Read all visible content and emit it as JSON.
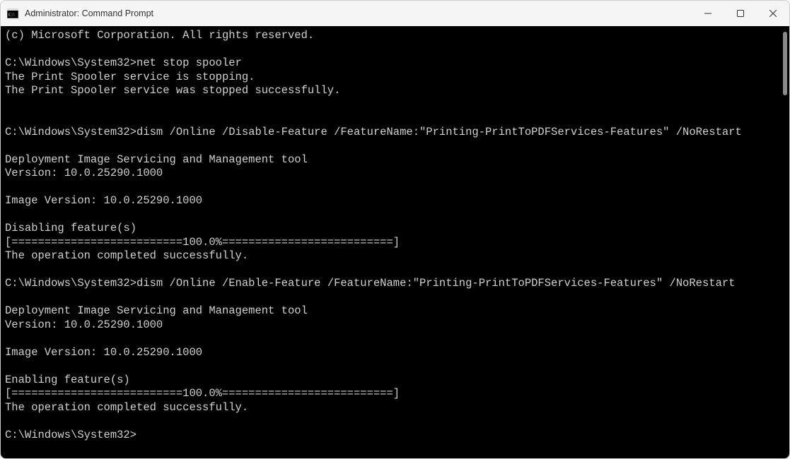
{
  "titlebar": {
    "title": "Administrator: Command Prompt"
  },
  "terminal": {
    "lines": [
      "(c) Microsoft Corporation. All rights reserved.",
      "",
      "C:\\Windows\\System32>net stop spooler",
      "The Print Spooler service is stopping.",
      "The Print Spooler service was stopped successfully.",
      "",
      "",
      "C:\\Windows\\System32>dism /Online /Disable-Feature /FeatureName:\"Printing-PrintToPDFServices-Features\" /NoRestart",
      "",
      "Deployment Image Servicing and Management tool",
      "Version: 10.0.25290.1000",
      "",
      "Image Version: 10.0.25290.1000",
      "",
      "Disabling feature(s)",
      "[==========================100.0%==========================]",
      "The operation completed successfully.",
      "",
      "C:\\Windows\\System32>dism /Online /Enable-Feature /FeatureName:\"Printing-PrintToPDFServices-Features\" /NoRestart",
      "",
      "Deployment Image Servicing and Management tool",
      "Version: 10.0.25290.1000",
      "",
      "Image Version: 10.0.25290.1000",
      "",
      "Enabling feature(s)",
      "[==========================100.0%==========================]",
      "The operation completed successfully.",
      "",
      "C:\\Windows\\System32>"
    ]
  }
}
